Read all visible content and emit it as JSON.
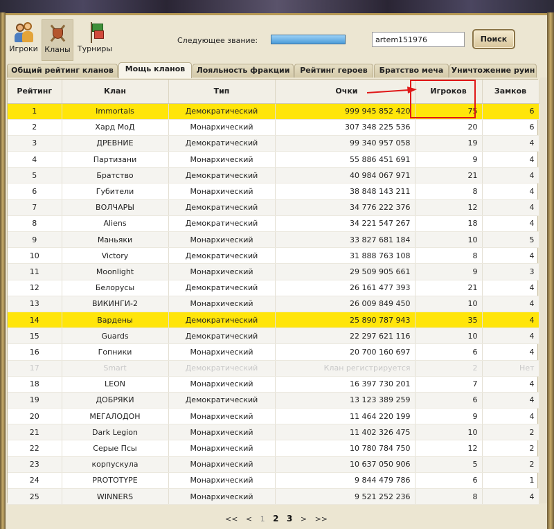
{
  "nav": {
    "players_label": "Игроки",
    "clans_label": "Кланы",
    "tournaments_label": "Турниры"
  },
  "rank": {
    "next_rank_label": "Следующее звание:",
    "progress": 1.0
  },
  "search": {
    "value": "artem151976",
    "button_label": "Поиск"
  },
  "tabs": [
    {
      "label": "Общий рейтинг кланов",
      "active": false
    },
    {
      "label": "Мощь кланов",
      "active": true
    },
    {
      "label": "Лояльность фракции",
      "active": false
    },
    {
      "label": "Рейтинг героев",
      "active": false
    },
    {
      "label": "Братство меча",
      "active": false
    },
    {
      "label": "Уничтожение руин",
      "active": false
    }
  ],
  "table": {
    "columns": [
      "Рейтинг",
      "Клан",
      "Тип",
      "Очки",
      "Игроков",
      "Замков"
    ],
    "rows": [
      {
        "rank": "1",
        "clan": "Immortals",
        "type": "Демократический",
        "points": "999 945 852 420",
        "players": "75",
        "castles": "6",
        "style": "hl"
      },
      {
        "rank": "2",
        "clan": "Хард МоД",
        "type": "Монархический",
        "points": "307 348 225 536",
        "players": "20",
        "castles": "6",
        "style": ""
      },
      {
        "rank": "3",
        "clan": "ДРЕВНИЕ",
        "type": "Демократический",
        "points": "99 340 957 058",
        "players": "19",
        "castles": "4",
        "style": "alt"
      },
      {
        "rank": "4",
        "clan": "Партизани",
        "type": "Монархический",
        "points": "55 886 451 691",
        "players": "9",
        "castles": "4",
        "style": ""
      },
      {
        "rank": "5",
        "clan": "Братство",
        "type": "Демократический",
        "points": "40 984 067 971",
        "players": "21",
        "castles": "4",
        "style": "alt"
      },
      {
        "rank": "6",
        "clan": "Губители",
        "type": "Монархический",
        "points": "38 848 143 211",
        "players": "8",
        "castles": "4",
        "style": ""
      },
      {
        "rank": "7",
        "clan": "ВОЛЧАРЫ",
        "type": "Демократический",
        "points": "34 776 222 376",
        "players": "12",
        "castles": "4",
        "style": "alt"
      },
      {
        "rank": "8",
        "clan": "Aliens",
        "type": "Демократический",
        "points": "34 221 547 267",
        "players": "18",
        "castles": "4",
        "style": ""
      },
      {
        "rank": "9",
        "clan": "Маньяки",
        "type": "Монархический",
        "points": "33 827 681 184",
        "players": "10",
        "castles": "5",
        "style": "alt"
      },
      {
        "rank": "10",
        "clan": "Victory",
        "type": "Демократический",
        "points": "31 888 763 108",
        "players": "8",
        "castles": "4",
        "style": ""
      },
      {
        "rank": "11",
        "clan": "Moonlight",
        "type": "Монархический",
        "points": "29 509 905 661",
        "players": "9",
        "castles": "3",
        "style": "alt"
      },
      {
        "rank": "12",
        "clan": "Белорусы",
        "type": "Демократический",
        "points": "26 161 477 393",
        "players": "21",
        "castles": "4",
        "style": ""
      },
      {
        "rank": "13",
        "clan": "ВИКИНГИ-2",
        "type": "Монархический",
        "points": "26 009 849 450",
        "players": "10",
        "castles": "4",
        "style": "alt"
      },
      {
        "rank": "14",
        "clan": "Вардены",
        "type": "Демократический",
        "points": "25 890 787 943",
        "players": "35",
        "castles": "4",
        "style": "hl"
      },
      {
        "rank": "15",
        "clan": "Guards",
        "type": "Демократический",
        "points": "22 297 621 116",
        "players": "10",
        "castles": "4",
        "style": "alt"
      },
      {
        "rank": "16",
        "clan": "Гопники",
        "type": "Монархический",
        "points": "20 700 160 697",
        "players": "6",
        "castles": "4",
        "style": ""
      },
      {
        "rank": "17",
        "clan": "Smart",
        "type": "Демократический",
        "points": "Клан регистрируется",
        "players": "2",
        "castles": "Нет",
        "style": "alt dim"
      },
      {
        "rank": "18",
        "clan": "LEON",
        "type": "Монархический",
        "points": "16 397 730 201",
        "players": "7",
        "castles": "4",
        "style": ""
      },
      {
        "rank": "19",
        "clan": "ДОБРЯКИ",
        "type": "Демократический",
        "points": "13 123 389 259",
        "players": "6",
        "castles": "4",
        "style": "alt"
      },
      {
        "rank": "20",
        "clan": "МЕГАЛОДОН",
        "type": "Монархический",
        "points": "11 464 220 199",
        "players": "9",
        "castles": "4",
        "style": ""
      },
      {
        "rank": "21",
        "clan": "Dark Legion",
        "type": "Монархический",
        "points": "11 402 326 475",
        "players": "10",
        "castles": "2",
        "style": "alt"
      },
      {
        "rank": "22",
        "clan": "Серые Псы",
        "type": "Монархический",
        "points": "10 780 784 750",
        "players": "12",
        "castles": "2",
        "style": ""
      },
      {
        "rank": "23",
        "clan": "корпускула",
        "type": "Монархический",
        "points": "10 637 050 906",
        "players": "5",
        "castles": "2",
        "style": "alt"
      },
      {
        "rank": "24",
        "clan": "PROTOTYPE",
        "type": "Монархический",
        "points": "9 844 479 786",
        "players": "6",
        "castles": "1",
        "style": ""
      },
      {
        "rank": "25",
        "clan": "WINNERS",
        "type": "Монархический",
        "points": "9 521 252 236",
        "players": "8",
        "castles": "4",
        "style": "alt"
      }
    ]
  },
  "pagination": {
    "first": "<<",
    "prev": "<",
    "pages": [
      "1",
      "2",
      "3"
    ],
    "current": "1",
    "next": ">",
    "last": ">>"
  },
  "colors": {
    "highlight_row": "#ffe50a",
    "annotation_red": "#e01818"
  }
}
